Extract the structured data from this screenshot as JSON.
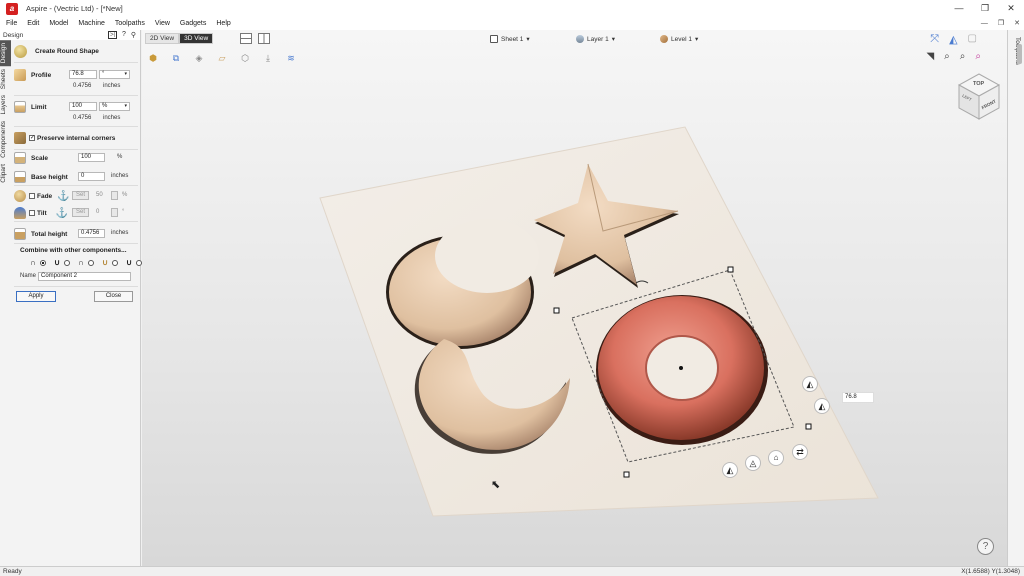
{
  "window": {
    "title": "Aspire - (Vectric Ltd) - [*New]",
    "min": "—",
    "max": "❐",
    "close": "✕"
  },
  "menu": [
    "File",
    "Edit",
    "Model",
    "Machine",
    "Toolpaths",
    "View",
    "Gadgets",
    "Help"
  ],
  "panel": {
    "head": "Design",
    "ctrls": [
      "ᐳ|",
      "?",
      "⚲"
    ],
    "tabs": [
      "Design",
      "Sheets",
      "Layers",
      "Components",
      "Clipart"
    ],
    "title": "Create Round Shape",
    "profile": {
      "label": "Profile",
      "value": "76.8",
      "unit": "°",
      "sub_value": "0.4756",
      "sub_unit": "inches"
    },
    "limit": {
      "label": "Limit",
      "value": "100",
      "unit": "%",
      "sub_value": "0.4756",
      "sub_unit": "inches"
    },
    "preserve": {
      "label": "Preserve internal corners",
      "checked": true
    },
    "scale": {
      "label": "Scale",
      "value": "100",
      "unit": "%"
    },
    "base_height": {
      "label": "Base height",
      "value": "0",
      "unit": "inches"
    },
    "fade": {
      "label": "Fade",
      "set": "Set",
      "value": "50",
      "unit": "%"
    },
    "tilt": {
      "label": "Tilt",
      "set": "Set",
      "value": "0",
      "unit": "°"
    },
    "total_height": {
      "label": "Total height",
      "value": "0.4756",
      "unit": "inches"
    },
    "combine_label": "Combine with other components...",
    "name_label": "Name",
    "name_value": "Component 2",
    "apply": "Apply",
    "close": "Close"
  },
  "view": {
    "tabs": [
      "2D View",
      "3D View"
    ],
    "active_tab": "3D View",
    "sheet": "Sheet 1",
    "layer": "Layer 1",
    "level": "Level 1",
    "cube": {
      "top": "TOP",
      "front": "FRONT",
      "left": "LEFT"
    },
    "angle_input": "76.8",
    "help": "?"
  },
  "right_tab": "Toolpaths",
  "status": {
    "left": "Ready",
    "right": "X(1.6588) Y(1.3048)"
  },
  "colors": {
    "torus": "#d9705f",
    "material": "#e6cdb4",
    "board": "#f1ebe3"
  }
}
